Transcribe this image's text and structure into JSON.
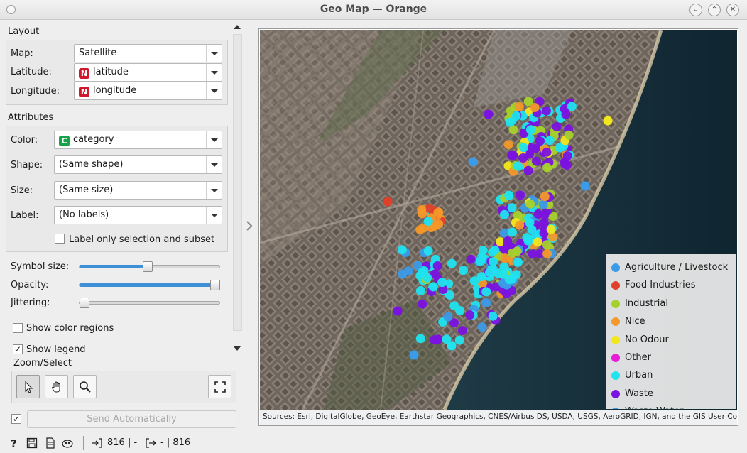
{
  "window": {
    "title": "Geo Map — Orange"
  },
  "layout": {
    "title": "Layout",
    "map_label": "Map:",
    "map_value": "Satellite",
    "latitude_label": "Latitude:",
    "latitude_badge": "N",
    "latitude_value": "latitude",
    "longitude_label": "Longitude:",
    "longitude_badge": "N",
    "longitude_value": "longitude"
  },
  "attributes": {
    "title": "Attributes",
    "color_label": "Color:",
    "color_badge": "C",
    "color_value": "category",
    "shape_label": "Shape:",
    "shape_value": "(Same shape)",
    "size_label": "Size:",
    "size_value": "(Same size)",
    "label_label": "Label:",
    "label_value": "(No labels)",
    "label_only_selection": "Label only selection and subset",
    "label_only_selection_checked": false
  },
  "sliders": {
    "symbol_size_label": "Symbol size:",
    "symbol_size_level": 0.45,
    "opacity_label": "Opacity:",
    "opacity_level": 1.0,
    "jittering_label": "Jittering:",
    "jittering_level": 0.0
  },
  "options": {
    "show_color_regions": "Show color regions",
    "show_color_regions_checked": false,
    "show_legend": "Show legend",
    "show_legend_checked": true
  },
  "zoom": {
    "title": "Zoom/Select"
  },
  "send": {
    "auto_checked": true,
    "label": "Send Automatically"
  },
  "status": {
    "input_count": "816 | -",
    "output_count": "- | 816"
  },
  "map": {
    "attribution": "Sources: Esri, DigitalGlobe, GeoEye, Earthstar Geographics, CNES/Airbus DS, USDA, USGS, AeroGRID, IGN, and the GIS User Community",
    "legend": [
      {
        "label": "Agriculture / Livestock",
        "color": "#3a9be8"
      },
      {
        "label": "Food Industries",
        "color": "#e0402a"
      },
      {
        "label": "Industrial",
        "color": "#a6d12b"
      },
      {
        "label": "Nice",
        "color": "#f3982a"
      },
      {
        "label": "No Odour",
        "color": "#f2e71c"
      },
      {
        "label": "Other",
        "color": "#e71ed7"
      },
      {
        "label": "Urban",
        "color": "#1fe3ef"
      },
      {
        "label": "Waste",
        "color": "#7a12e0"
      },
      {
        "label": "Waste Water",
        "color": "#3a9be8"
      }
    ]
  }
}
